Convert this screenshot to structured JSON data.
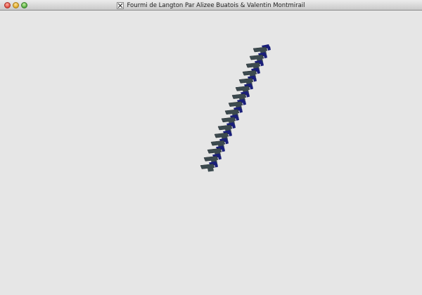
{
  "window": {
    "title": "Fourmi de Langton Par Alizee Buatois & Valentin Montmirail",
    "app_icon": "x11-icon",
    "controls": [
      "close",
      "minimize",
      "zoom"
    ]
  },
  "scene": {
    "background_color": "#e6e6e6",
    "cell_top_color": "#1a1f7a",
    "cell_side_color": "#3c4a4f",
    "cell_edge_color": "#2a3034"
  }
}
